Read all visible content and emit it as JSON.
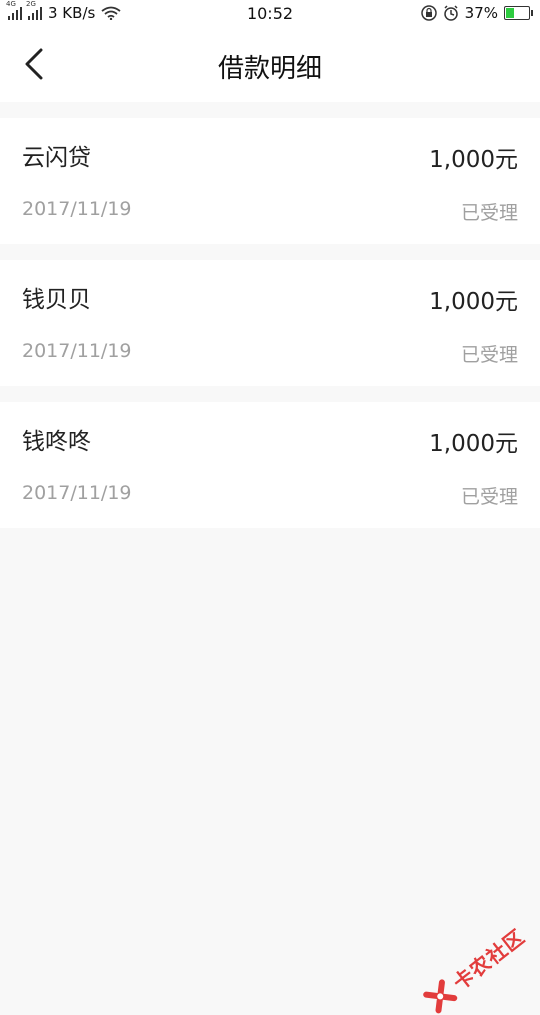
{
  "status_bar": {
    "network_left": "4G",
    "network_right": "2G",
    "speed": "3 KB/s",
    "time": "10:52",
    "battery_percent": "37%",
    "battery_level": 0.37,
    "icons": [
      "signal-icon",
      "signal-icon",
      "wifi-icon",
      "lock-icon",
      "alarm-icon",
      "battery-icon"
    ]
  },
  "header": {
    "title": "借款明细",
    "back_icon": "chevron-left-icon"
  },
  "loans": [
    {
      "name": "云闪贷",
      "amount": "1,000元",
      "date": "2017/11/19",
      "status": "已受理"
    },
    {
      "name": "钱贝贝",
      "amount": "1,000元",
      "date": "2017/11/19",
      "status": "已受理"
    },
    {
      "name": "钱咚咚",
      "amount": "1,000元",
      "date": "2017/11/19",
      "status": "已受理"
    }
  ],
  "watermark": {
    "text": "卡农社区"
  },
  "colors": {
    "background": "#f8f8f8",
    "card": "#ffffff",
    "primary_text": "#222222",
    "secondary_text": "#a0a0a0",
    "watermark": "#e23c3c",
    "battery": "#2ecc40"
  }
}
